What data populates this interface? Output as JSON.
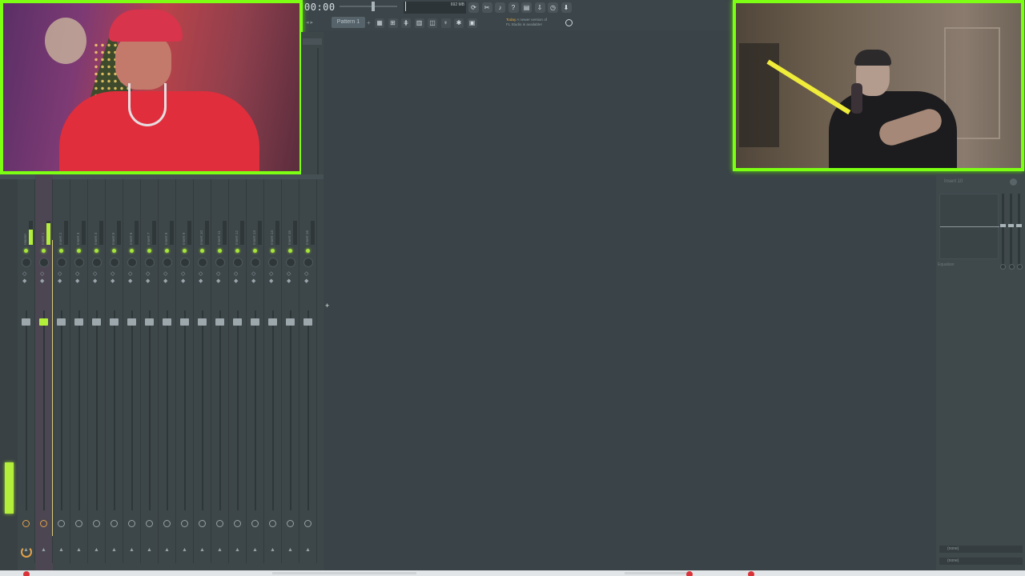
{
  "toolbar": {
    "time": "00:00",
    "memory": "692 MB",
    "cpu_value": "0",
    "pattern_label": "Pattern 1",
    "pattern_add": "+",
    "news_line1_prefix": "Today",
    "news_line1": "A newer version of",
    "news_line2": "FL Studio is available!",
    "icons": [
      "loop-icon",
      "cut-icon",
      "mic-icon",
      "help-icon",
      "save-icon",
      "export-icon",
      "clock-icon",
      "download-icon"
    ],
    "view_icons": [
      "playlist-icon",
      "piano-roll-icon",
      "mixer-icon",
      "channel-rack-icon",
      "browser-icon",
      "plugin-icon",
      "pin-icon",
      "link-icon"
    ]
  },
  "mixer": {
    "tracks": [
      {
        "name": "Master",
        "level": 0.65,
        "selected": false
      },
      {
        "name": "Insert 1",
        "level": 0.9,
        "selected": true
      },
      {
        "name": "Insert 2",
        "level": 0,
        "selected": false
      },
      {
        "name": "Insert 3",
        "level": 0,
        "selected": false
      },
      {
        "name": "Insert 4",
        "level": 0,
        "selected": false
      },
      {
        "name": "Insert 5",
        "level": 0,
        "selected": false
      },
      {
        "name": "Insert 6",
        "level": 0,
        "selected": false
      },
      {
        "name": "Insert 7",
        "level": 0,
        "selected": false
      },
      {
        "name": "Insert 8",
        "level": 0,
        "selected": false
      },
      {
        "name": "Insert 9",
        "level": 0,
        "selected": false
      },
      {
        "name": "Insert 10",
        "level": 0,
        "selected": false
      },
      {
        "name": "Insert 11",
        "level": 0,
        "selected": false
      },
      {
        "name": "Insert 12",
        "level": 0,
        "selected": false
      },
      {
        "name": "Insert 13",
        "level": 0,
        "selected": false
      },
      {
        "name": "Insert 14",
        "level": 0,
        "selected": false
      },
      {
        "name": "Insert 15",
        "level": 0,
        "selected": false
      },
      {
        "name": "Insert 16",
        "level": 0,
        "selected": false
      }
    ],
    "master_level": 0.6
  },
  "insert_panel": {
    "title": "Insert 10",
    "eq_label": "Equalizer",
    "slot1": "(none)",
    "slot2": "(none)"
  },
  "colors": {
    "accent": "#b3ef3a",
    "cam_border": "#7cff12",
    "background": "#3a4347"
  }
}
